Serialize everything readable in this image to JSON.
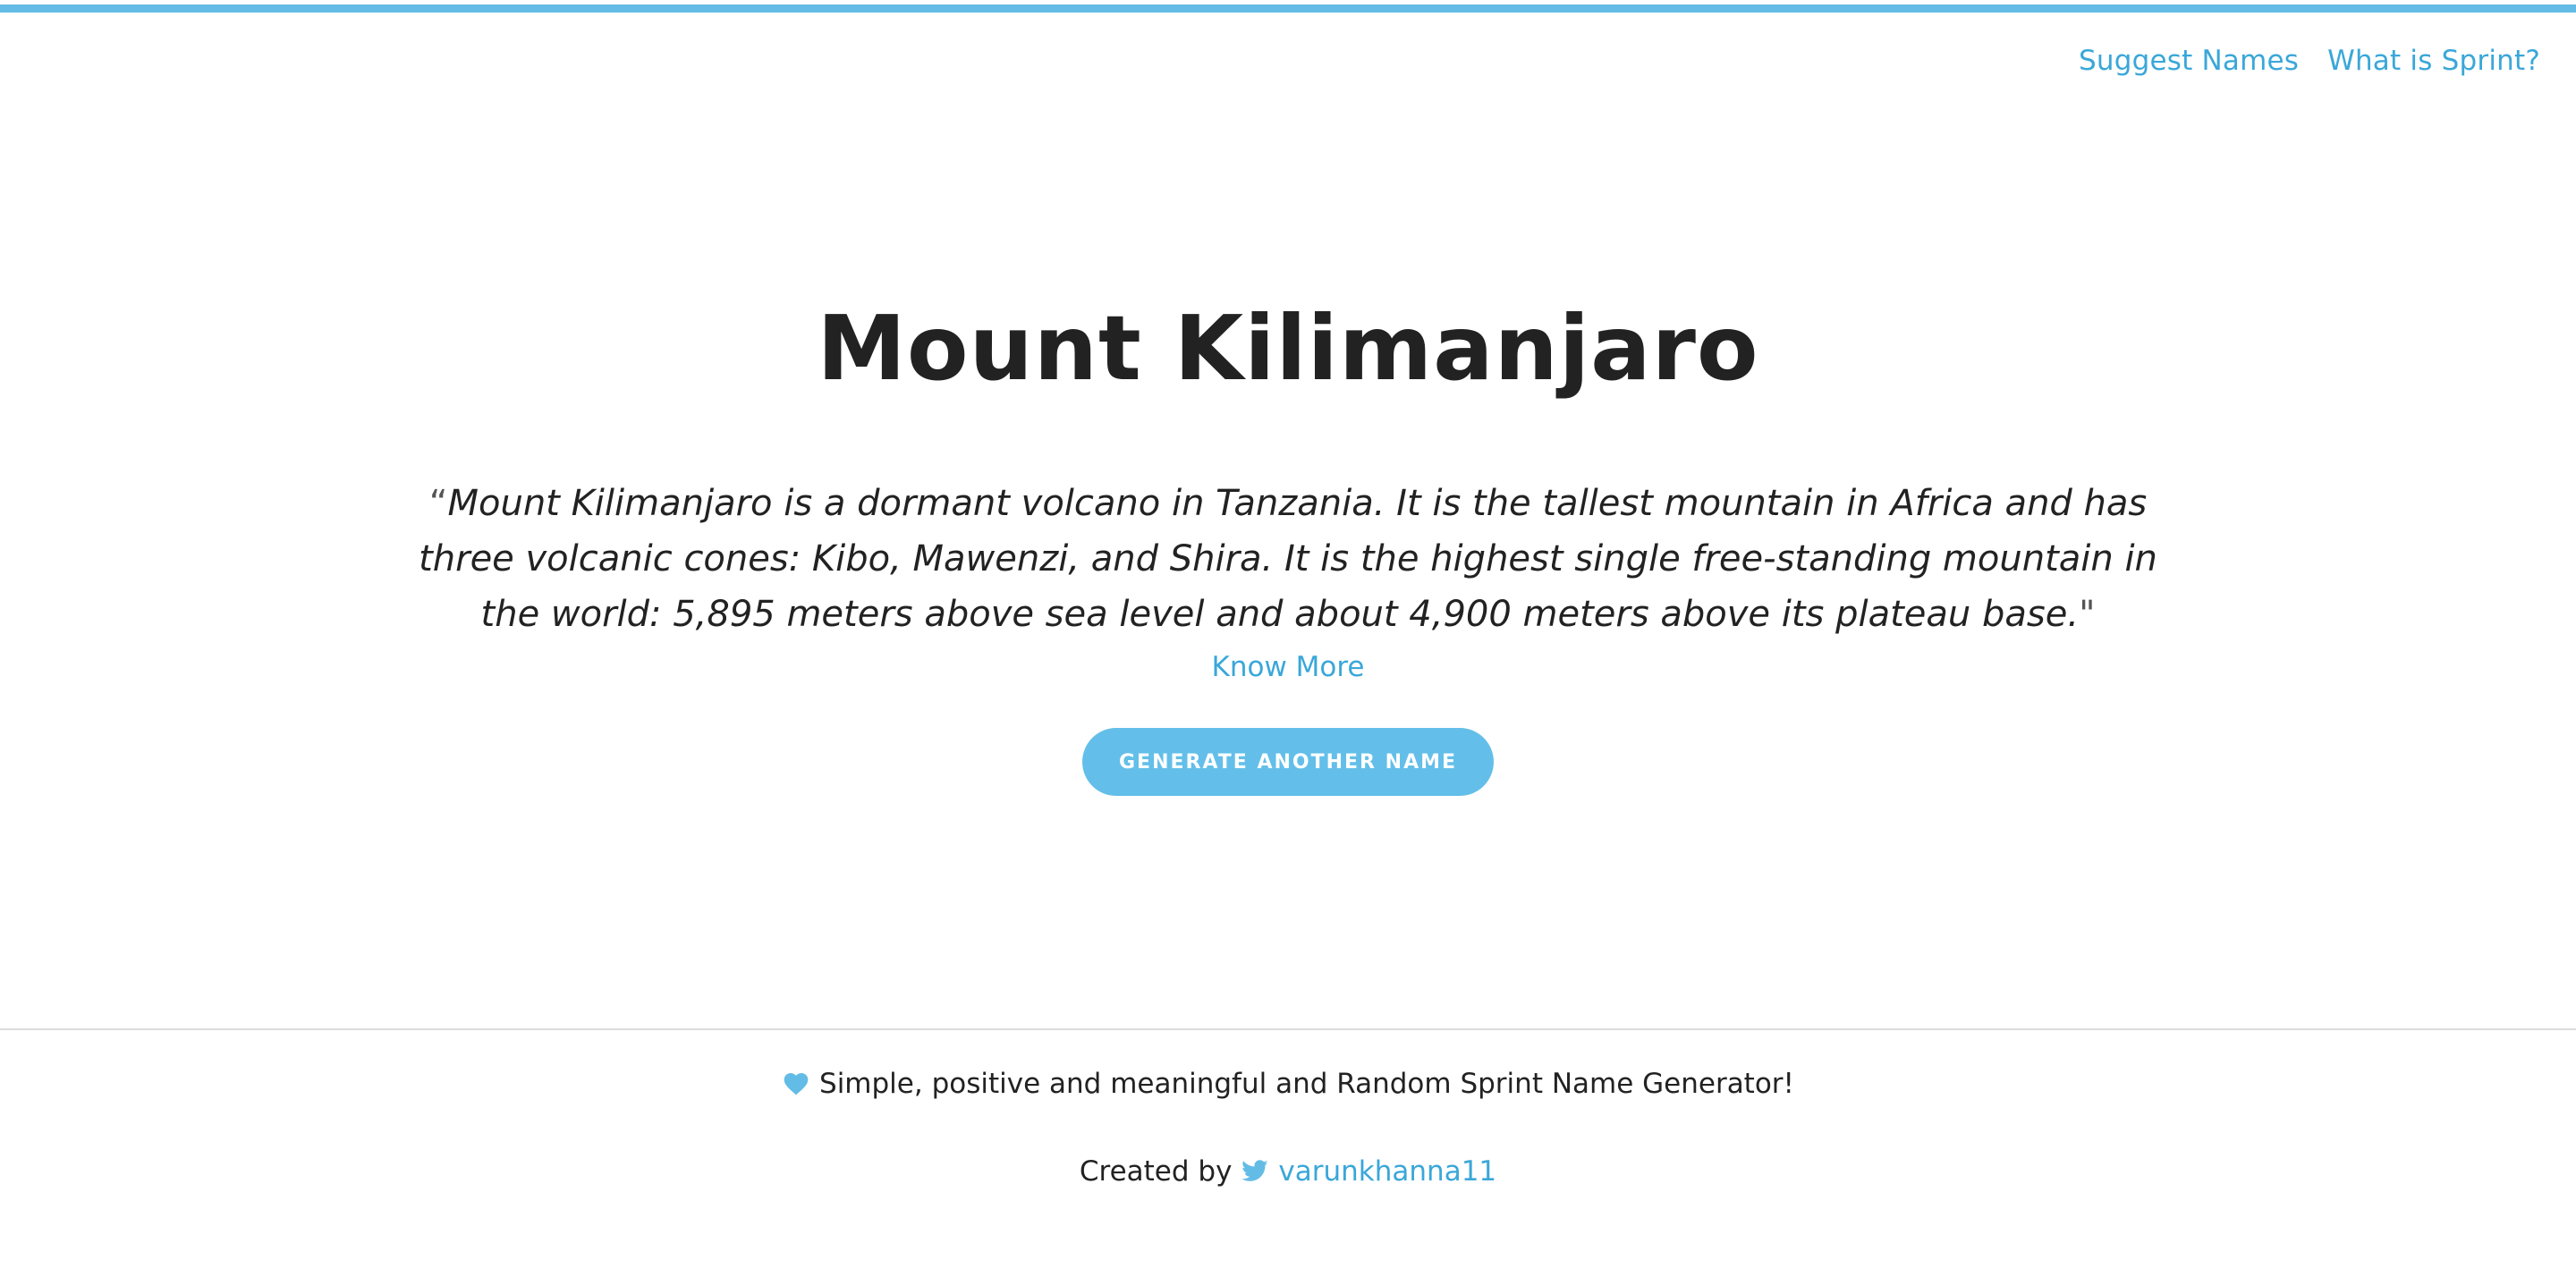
{
  "nav": {
    "links": [
      {
        "label": "Suggest Names"
      },
      {
        "label": "What is Sprint?"
      }
    ]
  },
  "main": {
    "title": "Mount Kilimanjaro",
    "open_quote": "“",
    "description": "Mount Kilimanjaro is a dormant volcano in Tanzania. It is the tallest mountain in Africa and has three volcanic cones: Kibo, Mawenzi, and Shira. It is the highest single free-standing mountain in the world: 5,895 meters above sea level and about 4,900 meters above its plateau base.",
    "close_quote": "\"",
    "know_more": "Know More",
    "generate_button": "GENERATE ANOTHER NAME"
  },
  "footer": {
    "tagline": "Simple, positive and meaningful and Random Sprint Name Generator!",
    "credit_prefix": "Created by",
    "author_handle": "varunkhanna11",
    "icons": {
      "tagline": "heart-icon",
      "credit": "twitter-icon"
    }
  },
  "colors": {
    "accent": "#63bce6",
    "link": "#3aa7d9",
    "text": "#222222",
    "divider": "#dcdcdc"
  }
}
